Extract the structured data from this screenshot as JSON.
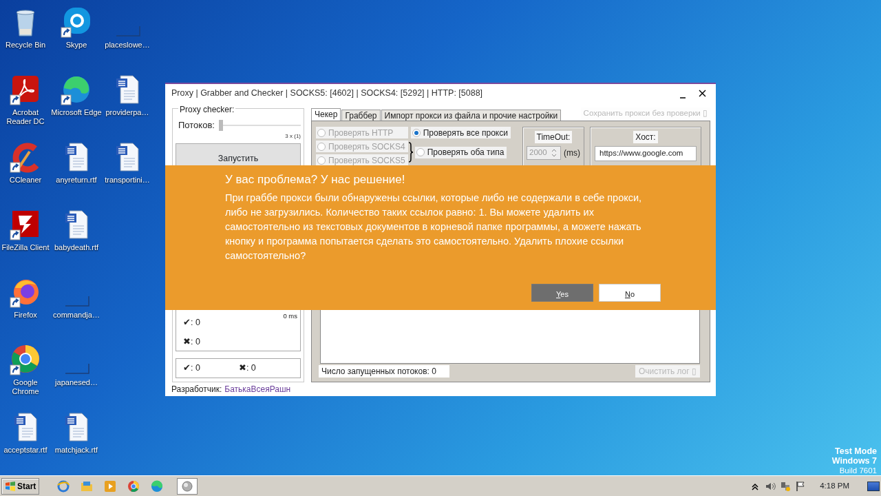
{
  "desktop": {
    "columns": [
      [
        {
          "label": "Recycle Bin",
          "kind": "recycle",
          "shortcut": false
        },
        {
          "label": "Acrobat\nReader DC",
          "kind": "pdf",
          "shortcut": true
        },
        {
          "label": "CCleaner",
          "kind": "ccleaner",
          "shortcut": true
        },
        {
          "label": "FileZilla Client",
          "kind": "filezilla",
          "shortcut": true
        },
        {
          "label": "Firefox",
          "kind": "firefox",
          "shortcut": true
        },
        {
          "label": "Google\nChrome",
          "kind": "chrome",
          "shortcut": true
        },
        {
          "label": "acceptstar.rtf",
          "kind": "word",
          "shortcut": false
        }
      ],
      [
        {
          "label": "Skype",
          "kind": "skype",
          "shortcut": true
        },
        {
          "label": "Microsoft Edge",
          "kind": "edge",
          "shortcut": true
        },
        {
          "label": "anyreturn.rtf",
          "kind": "word",
          "shortcut": false
        },
        {
          "label": "babydeath.rtf",
          "kind": "word",
          "shortcut": false
        },
        {
          "label": "commandja…",
          "kind": "blank",
          "shortcut": false
        },
        {
          "label": "japanesed…",
          "kind": "blank",
          "shortcut": false
        },
        {
          "label": "matchjack.rtf",
          "kind": "word",
          "shortcut": false
        }
      ],
      [
        {
          "label": "placeslowe…",
          "kind": "blank",
          "shortcut": false
        },
        {
          "label": "providerpa…",
          "kind": "word",
          "shortcut": false
        },
        {
          "label": "transportini…",
          "kind": "word",
          "shortcut": false
        }
      ]
    ]
  },
  "window": {
    "title": "Proxy | Grabber and Checker | SOCKS5: [4602] | SOCKS4: [5292] | HTTP: [5088]",
    "checker_group": {
      "legend": "Proxy checker:",
      "threads_label": "Потоков:",
      "threads": {
        "level": 0
      },
      "threads_reading": "3 x (1)",
      "start_button": "Запустить",
      "latency": "0 ms",
      "stats": [
        "✔:  0",
        "✖:  0"
      ],
      "totals": [
        "✔:  0",
        "✖:  0"
      ]
    },
    "tabs": [
      {
        "label": "Чекер",
        "selected": true
      },
      {
        "label": "Граббер",
        "selected": false
      },
      {
        "label": "Импорт прокси из файла и прочие настройки",
        "selected": false
      }
    ],
    "save_unchecked": {
      "label": "Сохранить прокси без проверки ▯",
      "disabled": true
    },
    "proxy_types": [
      {
        "label": "Проверять HTTP",
        "selected": false,
        "disabled": true
      },
      {
        "label": "Проверять SOCKS4",
        "selected": false,
        "disabled": true
      },
      {
        "label": "Проверять SOCKS5",
        "selected": false,
        "disabled": true
      }
    ],
    "all_option": {
      "label": "Проверять все прокси",
      "selected": true,
      "disabled": false
    },
    "both_option": {
      "label": "Проверять оба типа",
      "selected": false,
      "disabled": false
    },
    "timeout": {
      "legend": "TimeOut:",
      "value": "2000",
      "unit": "(ms)",
      "disabled": true
    },
    "host": {
      "legend": "Хост:",
      "value": "https://www.google.com"
    },
    "threads_status": "Число запущенных потоков: 0",
    "clear_log": {
      "label": "Очистить лог ▯",
      "disabled": true
    },
    "developer_label": "Разработчик:",
    "developer_link": "БатькаВсеяРашн"
  },
  "dialog": {
    "title": "У вас проблема? У нас решение!",
    "message": "При граббе прокси были обнаружены ссылки, которые либо не содержали в себе прокси, либо не загрузились. Количество таких ссылок равно: 1. Вы можете удалить их самостоятельно из текстовых документов в корневой папке программы, а можете нажать кнопку и программа попытается сделать это самостоятельно. Удалить плохие ссылки самостоятельно?",
    "buttons": [
      {
        "label": "Yes",
        "kind": "primary"
      },
      {
        "label": "No",
        "kind": "secondary"
      }
    ]
  },
  "taskbar": {
    "start": "Start",
    "apps": [
      {
        "kind": "ie",
        "active": false
      },
      {
        "kind": "explorer",
        "active": false
      },
      {
        "kind": "media",
        "active": false
      },
      {
        "kind": "chrome",
        "active": false
      },
      {
        "kind": "edge",
        "active": false
      },
      {
        "kind": "app",
        "active": true
      }
    ],
    "clock": "4:18 PM"
  },
  "os_notice": [
    "Test Mode",
    "Windows 7",
    "Build 7601"
  ]
}
